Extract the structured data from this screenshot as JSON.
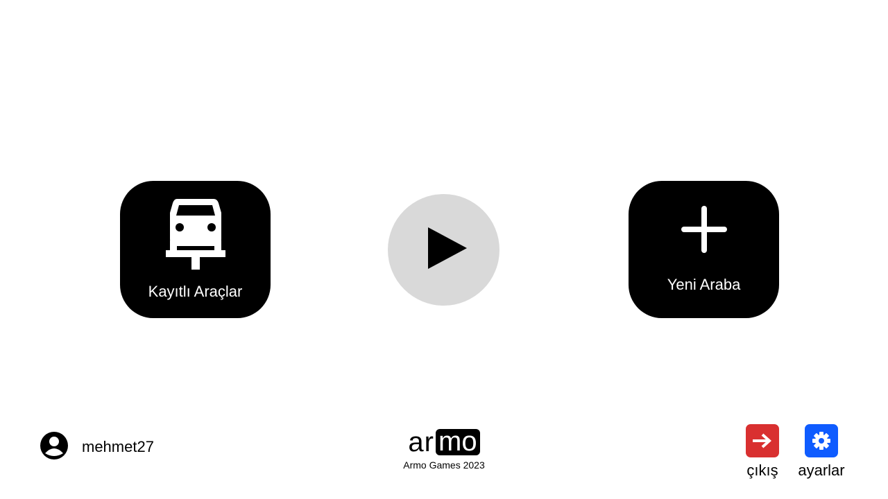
{
  "main": {
    "saved_vehicles": {
      "label": "Kayıtlı Araçlar",
      "icon": "car-lift-icon"
    },
    "play": {
      "icon": "play-icon"
    },
    "new_car": {
      "label": "Yeni Araba",
      "icon": "plus-icon"
    }
  },
  "footer": {
    "user": {
      "username": "mehmet27",
      "icon": "account-circle-icon"
    },
    "logo": {
      "text_plain": "ar",
      "text_boxed": "mo",
      "caption": "Armo Games 2023"
    },
    "exit": {
      "label": "çıkış",
      "icon": "exit-icon",
      "color": "#d93030"
    },
    "settings": {
      "label": "ayarlar",
      "icon": "gear-icon",
      "color": "#0f5cff"
    }
  }
}
